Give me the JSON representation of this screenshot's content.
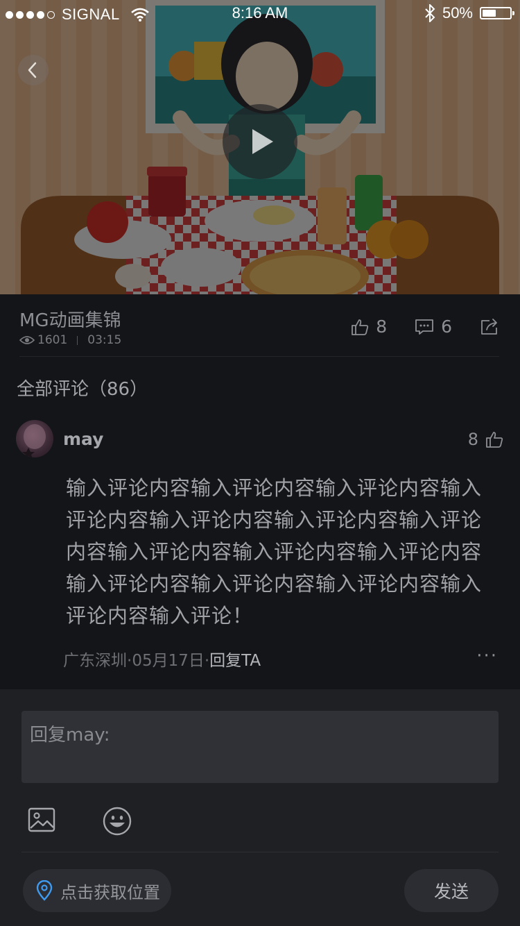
{
  "status_bar": {
    "carrier": "SIGNAL",
    "time": "8:16 AM",
    "battery": "50%",
    "battery_level": 0.5
  },
  "video": {
    "title": "MG动画集锦",
    "views": "1601",
    "duration": "03:15",
    "likes": "8",
    "comments": "6"
  },
  "comments_section": {
    "title": "全部评论（86）"
  },
  "comment": {
    "username": "may",
    "likes": "8",
    "text": "输入评论内容输入评论内容输入评论内容输入评论内容输入评论内容输入评论内容输入评论内容输入评论内容输入评论内容输入评论内容输入评论内容输入评论内容输入评论内容输入评论内容输入评论！",
    "location": "广东深圳",
    "date": "05月17日",
    "reply_label": "回复TA",
    "more": "···"
  },
  "composer": {
    "placeholder": "回复may:",
    "location_label": "点击获取位置",
    "send_label": "发送"
  },
  "colors": {
    "overlay": "#000000",
    "accent_location": "#3e9bf0"
  }
}
